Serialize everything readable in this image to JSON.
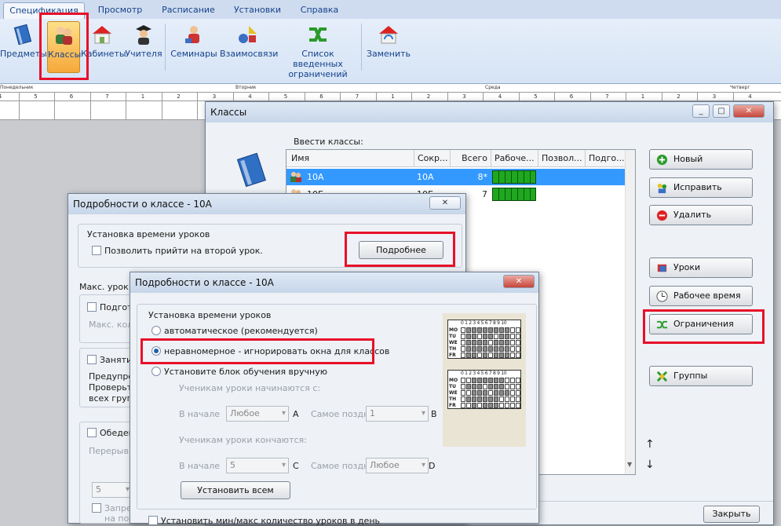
{
  "ribbon": {
    "tabs": [
      "Спецификация",
      "Просмотр",
      "Расписание",
      "Установки",
      "Справка"
    ],
    "buttons": [
      {
        "label": "Предметы",
        "icon": "book-icon"
      },
      {
        "label": "Классы",
        "icon": "classes-icon"
      },
      {
        "label": "Кабинеты",
        "icon": "house-icon"
      },
      {
        "label": "Учителя",
        "icon": "teacher-icon"
      },
      {
        "label": "Семинары",
        "icon": "seminar-icon"
      },
      {
        "label": "Взаимосвязи",
        "icon": "relations-icon"
      },
      {
        "label": "Список введенных ограничений",
        "icon": "constraints-icon"
      },
      {
        "label": "Заменить",
        "icon": "replace-icon"
      }
    ]
  },
  "timetable": {
    "days": [
      "Понедельник",
      "Вторник",
      "Среда",
      "Четверг"
    ],
    "periods": [
      "4",
      "5",
      "6",
      "7",
      "1",
      "2",
      "3",
      "4",
      "5",
      "6",
      "7",
      "1",
      "2",
      "3",
      "4",
      "5",
      "6",
      "7",
      "1",
      "2",
      "3",
      "4"
    ]
  },
  "classes_window": {
    "title": "Классы",
    "caption": "Ввести классы:",
    "columns": [
      "Имя",
      "Сокр...",
      "Всего",
      "Рабоче...",
      "Позвол...",
      "Подго..."
    ],
    "rows": [
      {
        "name": "10А",
        "short": "10А",
        "total": "8*"
      },
      {
        "name": "10Б",
        "short": "10Б",
        "total": "7"
      }
    ],
    "buttons": {
      "new": "Новый",
      "edit": "Исправить",
      "delete": "Удалить",
      "lessons": "Уроки",
      "worktime": "Рабочее время",
      "constraints": "Ограничения",
      "groups": "Группы",
      "close": "Закрыть"
    },
    "arrows": {
      "up": "↑",
      "down": "↓"
    }
  },
  "details_back": {
    "title": "Подробности о классе - 10А",
    "section": "Установка времени уроков",
    "allow_second": "Позволить прийти на второй урок.",
    "more_button": "Подробнее",
    "max_label": "Макс. урок",
    "items": [
      "Подгото",
      "Макс. кол",
      "Заняти",
      "Предупре",
      "Проверьте",
      "всех групп",
      "Обеден",
      "Перерыв",
      "5",
      "Запре",
      "на пос"
    ]
  },
  "details_front": {
    "title": "Подробности о классе - 10А",
    "section": "Установка времени уроков",
    "options": {
      "auto": "автоматическое (рекомендуется)",
      "uneven": "неравномерное - игнорировать окна для классов",
      "manual": "Установите блок обучения вручную"
    },
    "start_label": "Ученикам уроки начинаются с:",
    "end_label": "Ученикам уроки кончаются:",
    "at_start": "В начале",
    "latest": "Самое поздн",
    "combo_a": "Любое",
    "combo_b": "1",
    "combo_c": "5",
    "combo_d": "Любое",
    "letters": {
      "a": "A",
      "b": "B",
      "c": "C",
      "d": "D"
    },
    "set_all": "Установить всем",
    "bottom_check": "Установить мин/макс количество уроков в день",
    "mini": {
      "header": "0 1 2 3 4 5 6 7 8 9 10",
      "days": [
        "MO",
        "TU",
        "WE",
        "TH",
        "FR"
      ]
    }
  }
}
